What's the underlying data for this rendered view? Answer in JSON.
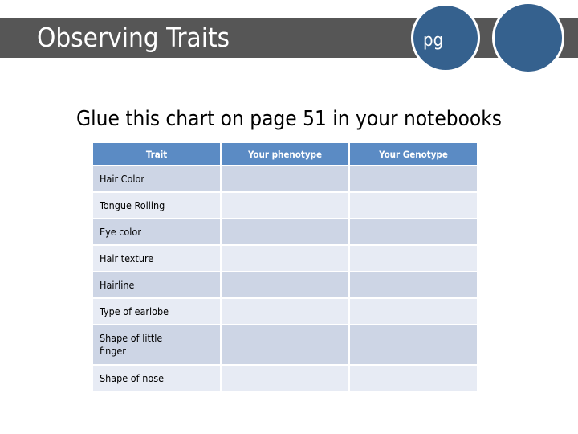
{
  "slide": {
    "title": "Observing Traits",
    "subtitle": "Glue this chart on page 51 in your notebooks",
    "circle_label": "pg",
    "colors": {
      "title_bar": "#565656",
      "circle_blue": "#35618E",
      "table_header_blue": "#5B8BC4",
      "row_odd": "#CDD5E5",
      "row_even": "#E7EBF4",
      "title_text": "#FFFFFF",
      "body_text": "#000000"
    }
  },
  "table": {
    "headers": [
      "Trait",
      "Your phenotype",
      "Your Genotype"
    ],
    "rows": [
      {
        "trait": "Hair Color",
        "phenotype": "",
        "genotype": ""
      },
      {
        "trait": "Tongue Rolling",
        "phenotype": "",
        "genotype": ""
      },
      {
        "trait": "Eye color",
        "phenotype": "",
        "genotype": ""
      },
      {
        "trait": "Hair texture",
        "phenotype": "",
        "genotype": ""
      },
      {
        "trait": "Hairline",
        "phenotype": "",
        "genotype": ""
      },
      {
        "trait": "Type of earlobe",
        "phenotype": "",
        "genotype": ""
      },
      {
        "trait": "Shape of little finger",
        "phenotype": "",
        "genotype": ""
      },
      {
        "trait": "Shape of nose",
        "phenotype": "",
        "genotype": ""
      }
    ]
  }
}
